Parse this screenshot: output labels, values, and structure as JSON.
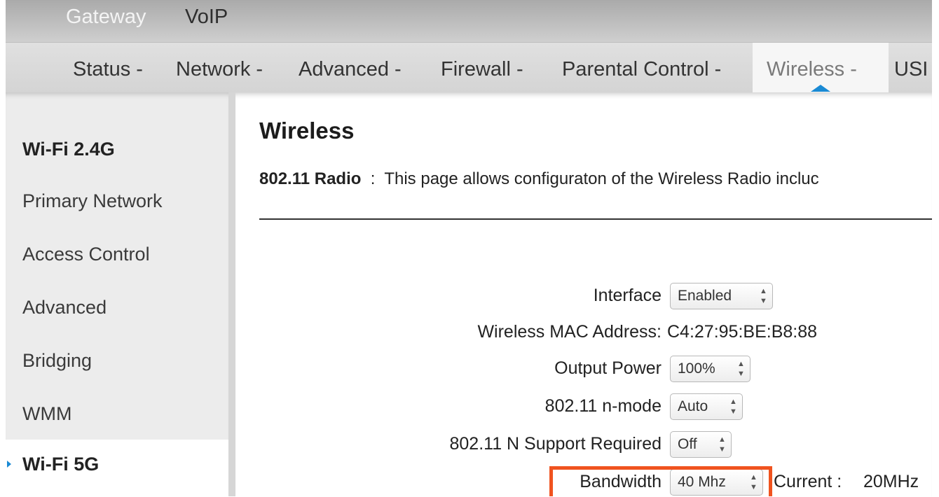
{
  "top_tabs": [
    {
      "label": "Gateway"
    },
    {
      "label": "VoIP"
    }
  ],
  "nav": {
    "items": [
      {
        "label": "Status -"
      },
      {
        "label": "Network -"
      },
      {
        "label": "Advanced -"
      },
      {
        "label": "Firewall -"
      },
      {
        "label": "Parental Control -"
      },
      {
        "label": "Wireless -",
        "active": true
      },
      {
        "label": "USI"
      }
    ]
  },
  "sidebar": {
    "items": [
      {
        "label": "Wi-Fi 2.4G",
        "type": "heading"
      },
      {
        "label": "Primary Network"
      },
      {
        "label": "Access Control"
      },
      {
        "label": "Advanced"
      },
      {
        "label": "Bridging"
      },
      {
        "label": "WMM"
      },
      {
        "label": "Wi-Fi 5G",
        "type": "heading",
        "selected": true
      }
    ]
  },
  "page": {
    "title": "Wireless",
    "intro_label": "802.11 Radio",
    "intro_sep": ":",
    "intro_text": "This page allows configuraton of the Wireless Radio incluc"
  },
  "form": {
    "interface": {
      "label": "Interface",
      "value": "Enabled"
    },
    "mac": {
      "label": "Wireless MAC Address:",
      "value": "C4:27:95:BE:B8:88"
    },
    "output_power": {
      "label": "Output Power",
      "value": "100%"
    },
    "n_mode": {
      "label": "802.11 n-mode",
      "value": "Auto"
    },
    "n_support": {
      "label": "802.11 N Support Required",
      "value": "Off"
    },
    "bandwidth": {
      "label": "Bandwidth",
      "value": "40 Mhz",
      "current_label": "Current :",
      "current_value": "20MHz"
    }
  },
  "colors": {
    "accent": "#1a8ad4",
    "highlight": "#f0531f"
  },
  "icons": {
    "select_arrows": "up-down-arrows-icon",
    "active_nav_caret": "caret-up-icon",
    "selected_side_marker": "triangle-right-icon"
  }
}
